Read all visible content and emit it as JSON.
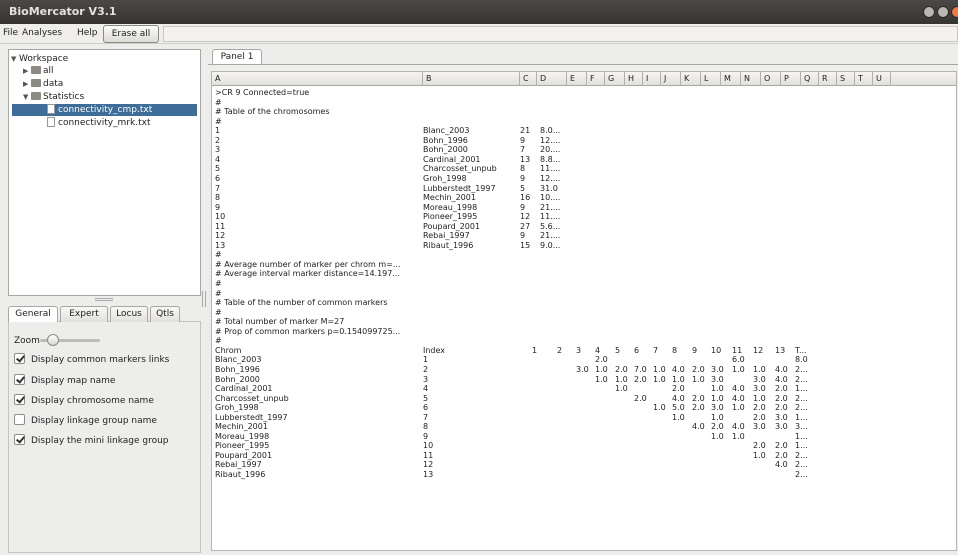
{
  "window": {
    "title": "BioMercator V3.1"
  },
  "menubar": {
    "file": "File",
    "analyses": "Analyses",
    "help": "Help",
    "erase_all": "Erase all"
  },
  "tree": {
    "root": "Workspace",
    "all": "all",
    "data": "data",
    "statistics": "Statistics",
    "file1": "connectivity_cmp.txt",
    "file2": "connectivity_mrk.txt"
  },
  "options": {
    "tabs": [
      "General",
      "Expert",
      "Locus",
      "Qtls"
    ],
    "zoom_label": "Zoom",
    "checks": [
      {
        "label": "Display common markers links",
        "checked": true
      },
      {
        "label": "Display map name",
        "checked": true
      },
      {
        "label": "Display chromosome name",
        "checked": true
      },
      {
        "label": "Display linkage group name",
        "checked": false
      },
      {
        "label": "Display the mini linkage group",
        "checked": true
      }
    ]
  },
  "panel": {
    "tab_label": "Panel 1"
  },
  "sheet": {
    "columns": [
      "A",
      "B",
      "C",
      "D",
      "E",
      "F",
      "G",
      "H",
      "I",
      "J",
      "K",
      "L",
      "M",
      "N",
      "O",
      "P",
      "Q",
      "R",
      "S",
      "T",
      "U"
    ],
    "rows": [
      [
        ">CR 9 Connected=true"
      ],
      [
        "#"
      ],
      [
        "# Table of the chromosomes"
      ],
      [
        "#"
      ],
      [
        "1",
        "Blanc_2003",
        "21",
        "8.0..."
      ],
      [
        "2",
        "Bohn_1996",
        "9",
        "12...."
      ],
      [
        "3",
        "Bohn_2000",
        "7",
        "20...."
      ],
      [
        "4",
        "Cardinal_2001",
        "13",
        "8.8..."
      ],
      [
        "5",
        "Charcosset_unpub",
        "8",
        "11...."
      ],
      [
        "6",
        "Groh_1998",
        "9",
        "12...."
      ],
      [
        "7",
        "Lubberstedt_1997",
        "5",
        "31.0"
      ],
      [
        "8",
        "Mechin_2001",
        "16",
        "10...."
      ],
      [
        "9",
        "Moreau_1998",
        "9",
        "21...."
      ],
      [
        "10",
        "Pioneer_1995",
        "12",
        "11...."
      ],
      [
        "11",
        "Poupard_2001",
        "27",
        "5.6..."
      ],
      [
        "12",
        "Rebai_1997",
        "9",
        "21...."
      ],
      [
        "13",
        "Ribaut_1996",
        "15",
        "9.0..."
      ],
      [
        "#"
      ],
      [
        "# Average number of marker per chrom m=..."
      ],
      [
        "# Average interval marker distance=14.197..."
      ],
      [
        "#"
      ],
      [
        "#"
      ],
      [
        "# Table of the number of common markers"
      ],
      [
        "#"
      ],
      [
        "# Total number of marker M=27"
      ],
      [
        "# Prop of common markers p=0.154099725..."
      ],
      [
        "#"
      ],
      [
        "Chrom",
        "Index",
        "1",
        "2",
        "3",
        "4",
        "5",
        "6",
        "7",
        "8",
        "9",
        "10",
        "11",
        "12",
        "13",
        "T..."
      ],
      [
        "Blanc_2003",
        "1",
        "",
        "",
        "",
        "2.0",
        "",
        "",
        "",
        "",
        "",
        "",
        "6.0",
        "",
        "",
        "8.0"
      ],
      [
        "Bohn_1996",
        "2",
        "",
        "",
        "3.0",
        "1.0",
        "2.0",
        "7.0",
        "1.0",
        "4.0",
        "2.0",
        "3.0",
        "1.0",
        "1.0",
        "4.0",
        "2..."
      ],
      [
        "Bohn_2000",
        "3",
        "",
        "",
        "",
        "1.0",
        "1.0",
        "2.0",
        "1.0",
        "1.0",
        "1.0",
        "3.0",
        "",
        "3.0",
        "4.0",
        "2..."
      ],
      [
        "Cardinal_2001",
        "4",
        "",
        "",
        "",
        "",
        "1.0",
        "",
        "",
        "2.0",
        "",
        "1.0",
        "4.0",
        "3.0",
        "2.0",
        "1..."
      ],
      [
        "Charcosset_unpub",
        "5",
        "",
        "",
        "",
        "",
        "",
        "2.0",
        "",
        "4.0",
        "2.0",
        "1.0",
        "4.0",
        "1.0",
        "2.0",
        "2..."
      ],
      [
        "Groh_1998",
        "6",
        "",
        "",
        "",
        "",
        "",
        "",
        "1.0",
        "5.0",
        "2.0",
        "3.0",
        "1.0",
        "2.0",
        "2.0",
        "2..."
      ],
      [
        "Lubberstedt_1997",
        "7",
        "",
        "",
        "",
        "",
        "",
        "",
        "",
        "1.0",
        "",
        "1.0",
        "",
        "2.0",
        "3.0",
        "1..."
      ],
      [
        "Mechin_2001",
        "8",
        "",
        "",
        "",
        "",
        "",
        "",
        "",
        "",
        "4.0",
        "2.0",
        "4.0",
        "3.0",
        "3.0",
        "3..."
      ],
      [
        "Moreau_1998",
        "9",
        "",
        "",
        "",
        "",
        "",
        "",
        "",
        "",
        "",
        "1.0",
        "1.0",
        "",
        "",
        "1..."
      ],
      [
        "Pioneer_1995",
        "10",
        "",
        "",
        "",
        "",
        "",
        "",
        "",
        "",
        "",
        "",
        "",
        "2.0",
        "2.0",
        "1..."
      ],
      [
        "Poupard_2001",
        "11",
        "",
        "",
        "",
        "",
        "",
        "",
        "",
        "",
        "",
        "",
        "",
        "1.0",
        "2.0",
        "2..."
      ],
      [
        "Rebai_1997",
        "12",
        "",
        "",
        "",
        "",
        "",
        "",
        "",
        "",
        "",
        "",
        "",
        "",
        "4.0",
        "2..."
      ],
      [
        "Ribaut_1996",
        "13",
        "",
        "",
        "",
        "",
        "",
        "",
        "",
        "",
        "",
        "",
        "",
        "",
        "",
        "2..."
      ]
    ]
  }
}
